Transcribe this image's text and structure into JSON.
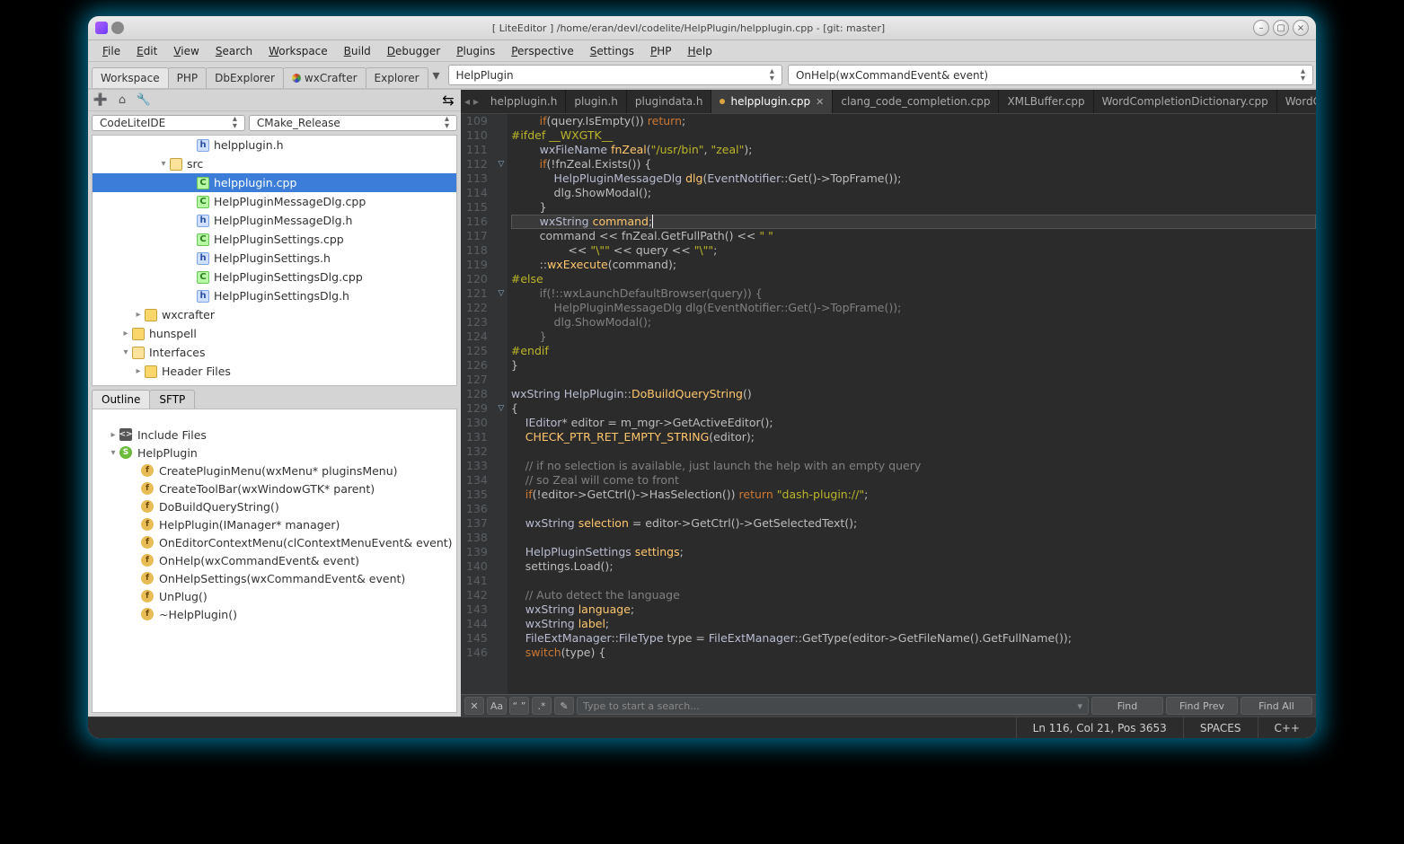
{
  "titlebar": {
    "title": "[ LiteEditor ] /home/eran/devl/codelite/HelpPlugin/helpplugin.cpp - [git: master]"
  },
  "menus": [
    "File",
    "Edit",
    "View",
    "Search",
    "Workspace",
    "Build",
    "Debugger",
    "Plugins",
    "Perspective",
    "Settings",
    "PHP",
    "Help"
  ],
  "wtabs": [
    "Workspace",
    "PHP",
    "DbExplorer",
    "wxCrafter",
    "Explorer"
  ],
  "wtab_active": 0,
  "top_combo1": "HelpPlugin",
  "top_combo2": "OnHelp(wxCommandEvent& event)",
  "side_combo1": "CodeLiteIDE",
  "side_combo2": "CMake_Release",
  "ws_tree": [
    {
      "ind": 3,
      "kind": "h",
      "label": "helpplugin.h"
    },
    {
      "ind": 2,
      "kind": "fold",
      "tw": "v",
      "label": "src"
    },
    {
      "ind": 3,
      "kind": "cpp",
      "label": "helpplugin.cpp",
      "sel": true
    },
    {
      "ind": 3,
      "kind": "cpp",
      "label": "HelpPluginMessageDlg.cpp"
    },
    {
      "ind": 3,
      "kind": "h",
      "label": "HelpPluginMessageDlg.h"
    },
    {
      "ind": 3,
      "kind": "cpp",
      "label": "HelpPluginSettings.cpp"
    },
    {
      "ind": 3,
      "kind": "h",
      "label": "HelpPluginSettings.h"
    },
    {
      "ind": 3,
      "kind": "cpp",
      "label": "HelpPluginSettingsDlg.cpp"
    },
    {
      "ind": 3,
      "kind": "h",
      "label": "HelpPluginSettingsDlg.h"
    },
    {
      "ind": 1,
      "kind": "fold",
      "tw": ">",
      "label": "wxcrafter"
    },
    {
      "ind": 0,
      "kind": "fold",
      "tw": ">",
      "label": "hunspell"
    },
    {
      "ind": 0,
      "kind": "fold",
      "tw": "v",
      "label": "Interfaces"
    },
    {
      "ind": 1,
      "kind": "fold",
      "tw": ">",
      "label": "Header Files"
    }
  ],
  "otabs": [
    "Outline",
    "SFTP"
  ],
  "outline": {
    "include": "Include Files",
    "class": "HelpPlugin",
    "methods": [
      "CreatePluginMenu(wxMenu* pluginsMenu)",
      "CreateToolBar(wxWindowGTK* parent)",
      "DoBuildQueryString()",
      "HelpPlugin(IManager* manager)",
      "OnEditorContextMenu(clContextMenuEvent& event)",
      "OnHelp(wxCommandEvent& event)",
      "OnHelpSettings(wxCommandEvent& event)",
      "UnPlug()",
      "~HelpPlugin()"
    ]
  },
  "file_tabs": [
    "helpplugin.h",
    "plugin.h",
    "plugindata.h",
    "helpplugin.cpp",
    "clang_code_completion.cpp",
    "XMLBuffer.cpp",
    "WordCompletionDictionary.cpp",
    "WordCompletion"
  ],
  "file_tab_active": 3,
  "line_start": 109,
  "line_end": 146,
  "code_html": [
    "        <span class='kw'>if</span>(query.IsEmpty()) <span class='kw'>return</span>;",
    "<span class='pp'>#ifdef __WXGTK__</span>",
    "        <span class='ty'>wxFileName</span> <span class='fn'>fnZeal</span>(<span class='str'>\"/usr/bin\"</span>, <span class='str'>\"zeal\"</span>);",
    "        <span class='kw'>if</span>(!fnZeal.Exists()) {",
    "            <span class='ty'>HelpPluginMessageDlg</span> <span class='fn'>dlg</span>(<span class='ty'>EventNotifier</span>::Get()->TopFrame());",
    "            dlg.ShowModal();",
    "        }",
    "        <span class='ty'>wxString</span> <span class='fn'>command</span>;<span class='cursor'></span>",
    "        command << fnZeal.GetFullPath() << <span class='str'>\" \"</span>",
    "                << <span class='str'>\"\\\"\"</span> << query << <span class='str'>\"\\\"\"</span>;",
    "        ::<span class='fn'>wxExecute</span>(command);",
    "<span class='pp'>#else</span>",
    "        <span class='cmt'>if(!::wxLaunchDefaultBrowser(query)) {</span>",
    "            <span class='cmt'>HelpPluginMessageDlg dlg(EventNotifier::Get()->TopFrame());</span>",
    "            <span class='cmt'>dlg.ShowModal();</span>",
    "        <span class='cmt'>}</span>",
    "<span class='pp'>#endif</span>",
    "}",
    "",
    "<span class='ty'>wxString</span> <span class='ty'>HelpPlugin</span>::<span class='fn'>DoBuildQueryString</span>()",
    "{",
    "    <span class='ty'>IEditor</span>* editor = m_mgr->GetActiveEditor();",
    "    <span class='fn'>CHECK_PTR_RET_EMPTY_STRING</span>(editor);",
    "",
    "    <span class='cmt'>// if no selection is available, just launch the help with an empty query</span>",
    "    <span class='cmt'>// so Zeal will come to front</span>",
    "    <span class='kw'>if</span>(!editor->GetCtrl()->HasSelection()) <span class='kw'>return</span> <span class='str'>\"dash-plugin://\"</span>;",
    "",
    "    <span class='ty'>wxString</span> <span class='fn'>selection</span> = editor->GetCtrl()->GetSelectedText();",
    "",
    "    <span class='ty'>HelpPluginSettings</span> <span class='fn'>settings</span>;",
    "    settings.Load();",
    "",
    "    <span class='cmt'>// Auto detect the language</span>",
    "    <span class='ty'>wxString</span> <span class='fn'>language</span>;",
    "    <span class='ty'>wxString</span> <span class='fn'>label</span>;",
    "    <span class='ty'>FileExtManager</span>::<span class='ty'>FileType</span> type = <span class='ty'>FileExtManager</span>::GetType(editor->GetFileName().GetFullName());",
    "    <span class='kw'>switch</span>(type) {"
  ],
  "current_line_idx": 7,
  "findbar": {
    "placeholder": "Type to start a search...",
    "btn_find": "Find",
    "btn_prev": "Find Prev",
    "btn_all": "Find All",
    "case": "Aa",
    "quotes": "“ ”",
    "regex": ".*",
    "wand": "✎"
  },
  "status": {
    "pos": "Ln 116, Col 21, Pos 3653",
    "spaces": "SPACES",
    "lang": "C++"
  }
}
